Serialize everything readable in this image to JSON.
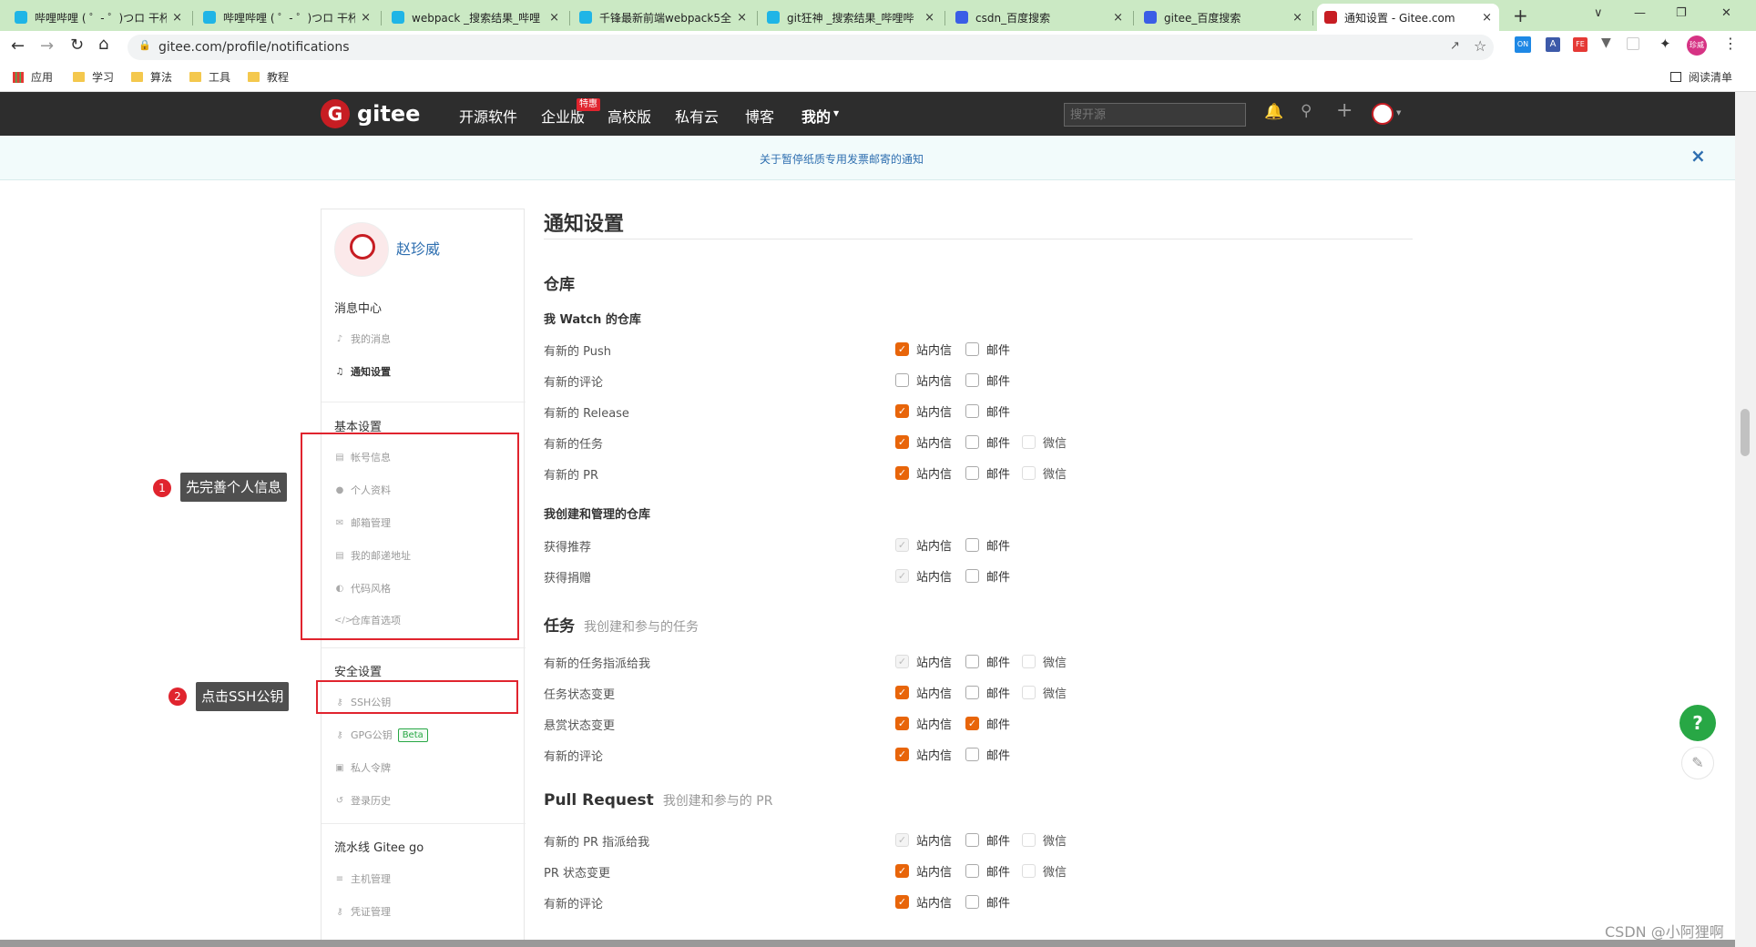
{
  "browser": {
    "tabs": [
      {
        "title": "哔哩哔哩 ( ゜- ゜)つロ 干杯",
        "fav": "#1fb5e6"
      },
      {
        "title": "哔哩哔哩 ( ゜- ゜)つロ 干杯",
        "fav": "#1fb5e6"
      },
      {
        "title": "webpack _搜索结果_哔哩",
        "fav": "#1fb5e6"
      },
      {
        "title": "千锋最新前端webpack5全",
        "fav": "#1fb5e6"
      },
      {
        "title": "git狂神 _搜索结果_哔哩哔",
        "fav": "#1fb5e6"
      },
      {
        "title": "csdn_百度搜索",
        "fav": "#3a5de6"
      },
      {
        "title": "gitee_百度搜索",
        "fav": "#3a5de6"
      },
      {
        "title": "通知设置 - Gitee.com",
        "fav": "#c71d23"
      }
    ],
    "url": "gitee.com/profile/notifications",
    "bookmarks": [
      "应用",
      "学习",
      "算法",
      "工具",
      "教程"
    ],
    "reading_list": "阅读清单",
    "profile_initials": "珍威"
  },
  "header": {
    "logo_text": "gitee",
    "nav": [
      "开源软件",
      "企业版",
      "高校版",
      "私有云",
      "博客",
      "我的"
    ],
    "hot_badge": "特惠",
    "search_placeholder": "搜开源"
  },
  "notice": {
    "text": "关于暂停纸质专用发票邮寄的通知",
    "close": "×"
  },
  "sidebar": {
    "username": "赵珍威",
    "groups": [
      {
        "title": "消息中心",
        "items": [
          {
            "label": "我的消息",
            "icon": "bell-icon"
          },
          {
            "label": "通知设置",
            "icon": "speaker-icon"
          }
        ]
      },
      {
        "title": "基本设置",
        "items": [
          {
            "label": "帐号信息",
            "icon": "card-icon"
          },
          {
            "label": "个人资料",
            "icon": "user-icon"
          },
          {
            "label": "邮箱管理",
            "icon": "mail-icon"
          },
          {
            "label": "我的邮递地址",
            "icon": "address-icon"
          },
          {
            "label": "代码风格",
            "icon": "palette-icon"
          },
          {
            "label": "仓库首选项",
            "icon": "code-icon"
          }
        ]
      },
      {
        "title": "安全设置",
        "items": [
          {
            "label": "SSH公钥",
            "icon": "key-icon"
          },
          {
            "label": "GPG公钥",
            "icon": "key-icon",
            "badge": "Beta"
          },
          {
            "label": "私人令牌",
            "icon": "lock-icon"
          },
          {
            "label": "登录历史",
            "icon": "history-icon"
          }
        ]
      },
      {
        "title": "流水线 Gitee go",
        "items": [
          {
            "label": "主机管理",
            "icon": "server-icon"
          },
          {
            "label": "凭证管理",
            "icon": "key-icon"
          }
        ]
      }
    ]
  },
  "main": {
    "title": "通知设置",
    "option_labels": {
      "site": "站内信",
      "mail": "邮件",
      "wechat": "微信"
    },
    "sections": [
      {
        "title": "仓库",
        "subtitle": "",
        "groups": [
          {
            "title": "我 Watch 的仓库",
            "rows": [
              {
                "label": "有新的 Push",
                "site": "on",
                "mail": "off"
              },
              {
                "label": "有新的评论",
                "site": "off",
                "mail": "off"
              },
              {
                "label": "有新的 Release",
                "site": "on",
                "mail": "off"
              },
              {
                "label": "有新的任务",
                "site": "on",
                "mail": "off",
                "wechat": "fade"
              },
              {
                "label": "有新的 PR",
                "site": "on",
                "mail": "off",
                "wechat": "fade"
              }
            ]
          },
          {
            "title": "我创建和管理的仓库",
            "rows": [
              {
                "label": "获得推荐",
                "site": "dis",
                "mail": "off"
              },
              {
                "label": "获得捐赠",
                "site": "dis",
                "mail": "off"
              }
            ]
          }
        ]
      },
      {
        "title": "任务",
        "subtitle": "我创建和参与的任务",
        "groups": [
          {
            "title": "",
            "rows": [
              {
                "label": "有新的任务指派给我",
                "site": "dis",
                "mail": "off",
                "wechat": "fade"
              },
              {
                "label": "任务状态变更",
                "site": "on",
                "mail": "off",
                "wechat": "fade"
              },
              {
                "label": "悬赏状态变更",
                "site": "on",
                "mail": "on"
              },
              {
                "label": "有新的评论",
                "site": "on",
                "mail": "off"
              }
            ]
          }
        ]
      },
      {
        "title": "Pull Request",
        "subtitle": "我创建和参与的 PR",
        "groups": [
          {
            "title": "",
            "rows": [
              {
                "label": "有新的 PR 指派给我",
                "site": "dis",
                "mail": "off",
                "wechat": "fade"
              },
              {
                "label": "PR 状态变更",
                "site": "on",
                "mail": "off",
                "wechat": "fade"
              },
              {
                "label": "有新的评论",
                "site": "on",
                "mail": "off"
              }
            ]
          }
        ]
      }
    ]
  },
  "annotations": [
    {
      "num": "1",
      "text": "先完善个人信息"
    },
    {
      "num": "2",
      "text": "点击SSH公钥"
    }
  ],
  "float": {
    "help": "?"
  },
  "watermark": "CSDN @小阿狸啊"
}
